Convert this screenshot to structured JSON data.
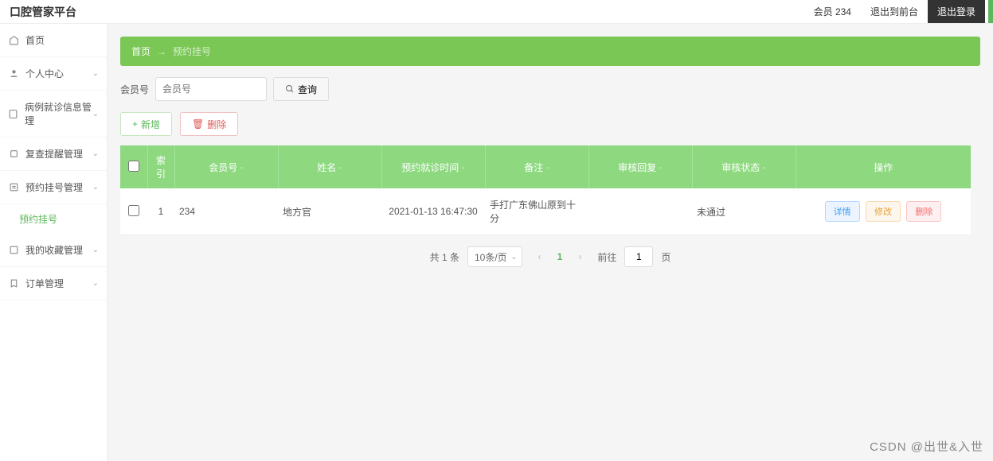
{
  "header": {
    "logo": "口腔管家平台",
    "member": "会员 234",
    "front": "退出到前台",
    "logout": "退出登录"
  },
  "sidebar": {
    "items": [
      {
        "icon": "home",
        "label": "首页"
      },
      {
        "icon": "user",
        "label": "个人中心",
        "chev": true
      },
      {
        "icon": "doc",
        "label": "病例就诊信息管理",
        "chev": true
      },
      {
        "icon": "bell",
        "label": "复查提醒管理",
        "chev": true
      },
      {
        "icon": "reg",
        "label": "预约挂号管理",
        "chev": true,
        "open": true
      },
      {
        "icon": "star",
        "label": "我的收藏管理",
        "chev": true
      },
      {
        "icon": "order",
        "label": "订单管理",
        "chev": true
      }
    ],
    "sub": "预约挂号"
  },
  "breadcrumb": {
    "home": "首页",
    "arrow": "→",
    "current": "预约挂号"
  },
  "filter": {
    "label": "会员号",
    "placeholder": "会员号",
    "search": "查询"
  },
  "actions": {
    "add": "新增",
    "del": "删除"
  },
  "table": {
    "headers": [
      "",
      "索引",
      "会员号",
      "姓名",
      "预约就诊时间",
      "备注",
      "审核回复",
      "审核状态",
      "操作"
    ],
    "row": {
      "index": "1",
      "member": "234",
      "name": "地方官",
      "time": "2021-01-13 16:47:30",
      "note": "手打广东佛山原到十分",
      "reply": "",
      "status": "未通过"
    },
    "ops": {
      "detail": "详情",
      "edit": "修改",
      "del": "删除"
    }
  },
  "pagination": {
    "total": "共 1 条",
    "size": "10条/页",
    "page": "1",
    "goto": "前往",
    "pg": "1",
    "suffix": "页"
  },
  "watermark": "CSDN @出世&入世"
}
